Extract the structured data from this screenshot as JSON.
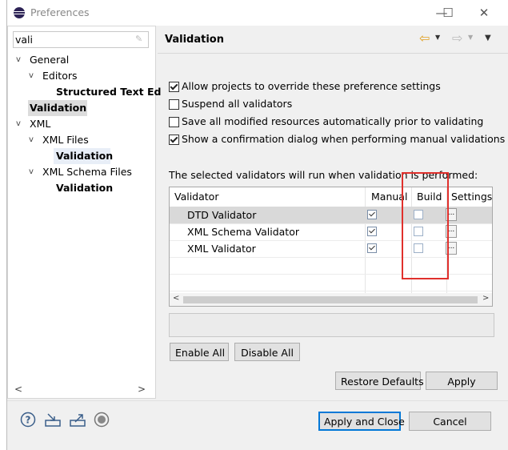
{
  "window": {
    "title": "Preferences"
  },
  "filter": {
    "value": "vali"
  },
  "tree": [
    {
      "label": "General"
    },
    {
      "label": "Editors"
    },
    {
      "label": "Structured Text Ed"
    },
    {
      "label": "Validation"
    },
    {
      "label": "XML"
    },
    {
      "label": "XML Files"
    },
    {
      "label": "Validation"
    },
    {
      "label": "XML Schema Files"
    },
    {
      "label": "Validation"
    }
  ],
  "page": {
    "title": "Validation"
  },
  "options": [
    {
      "label": "Allow projects to override these preference settings",
      "checked": true
    },
    {
      "label": "Suspend all validators",
      "checked": false
    },
    {
      "label": "Save all modified resources automatically prior to validating",
      "checked": false
    },
    {
      "label": "Show a confirmation dialog when performing manual validations",
      "checked": true
    }
  ],
  "validators_note": "The selected validators will run when validation is performed:",
  "table": {
    "headers": [
      "Validator",
      "Manual",
      "Build",
      "Settings"
    ],
    "rows": [
      {
        "name": "DTD Validator",
        "manual": true,
        "build": false,
        "settings": "..."
      },
      {
        "name": "XML Schema Validator",
        "manual": true,
        "build": false,
        "settings": "..."
      },
      {
        "name": "XML Validator",
        "manual": true,
        "build": false,
        "settings": "..."
      }
    ]
  },
  "buttons": {
    "enable_all": "Enable All",
    "disable_all": "Disable All",
    "restore_defaults": "Restore Defaults",
    "apply": "Apply",
    "apply_and_close": "Apply and Close",
    "cancel": "Cancel"
  },
  "window_controls": {
    "minimize": "—",
    "maximize": "☐",
    "close": "✕"
  },
  "icons": {
    "help": "help-icon",
    "import": "import-icon",
    "export": "export-icon",
    "oomph": "preference-recorder-icon"
  },
  "colors": {
    "highlight_box": "#e0302c",
    "default_button_border": "#0078d7"
  }
}
